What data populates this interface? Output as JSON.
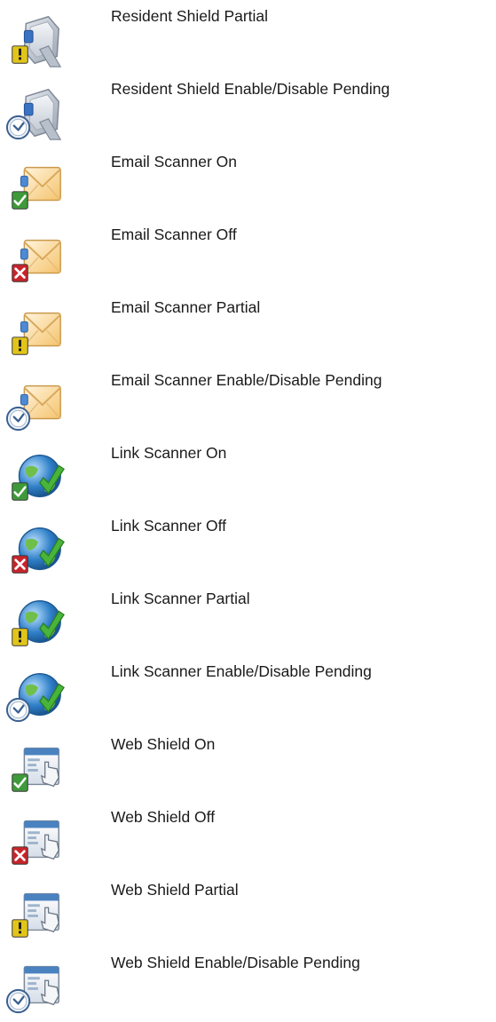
{
  "items": [
    {
      "label": "Resident Shield Partial",
      "icon": "resident-shield-icon",
      "status": "partial"
    },
    {
      "label": "Resident Shield Enable/Disable Pending",
      "icon": "resident-shield-icon",
      "status": "pending"
    },
    {
      "label": "Email Scanner On",
      "icon": "email-scanner-icon",
      "status": "on"
    },
    {
      "label": "Email Scanner Off",
      "icon": "email-scanner-icon",
      "status": "off"
    },
    {
      "label": "Email Scanner Partial",
      "icon": "email-scanner-icon",
      "status": "partial"
    },
    {
      "label": "Email Scanner Enable/Disable Pending",
      "icon": "email-scanner-icon",
      "status": "pending"
    },
    {
      "label": "Link Scanner On",
      "icon": "link-scanner-icon",
      "status": "on"
    },
    {
      "label": "Link Scanner Off",
      "icon": "link-scanner-icon",
      "status": "off"
    },
    {
      "label": "Link Scanner Partial",
      "icon": "link-scanner-icon",
      "status": "partial"
    },
    {
      "label": "Link Scanner Enable/Disable Pending",
      "icon": "link-scanner-icon",
      "status": "pending"
    },
    {
      "label": "Web Shield On",
      "icon": "web-shield-icon",
      "status": "on"
    },
    {
      "label": "Web Shield Off",
      "icon": "web-shield-icon",
      "status": "off"
    },
    {
      "label": "Web Shield Partial",
      "icon": "web-shield-icon",
      "status": "partial"
    },
    {
      "label": "Web Shield Enable/Disable Pending",
      "icon": "web-shield-icon",
      "status": "pending"
    }
  ],
  "colors": {
    "on": "#3f9a3a",
    "off": "#c8242a",
    "partial": "#e2c51a",
    "pending": "#3a5f8f",
    "envelope": "#f5c36b",
    "globe": "#2f7fc8",
    "window": "#4a82c0"
  }
}
